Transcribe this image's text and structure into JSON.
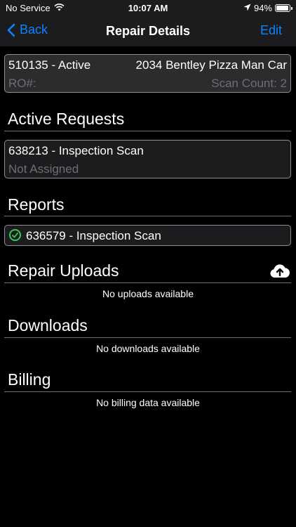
{
  "status": {
    "carrier": "No Service",
    "time": "10:07 AM",
    "battery": "94%",
    "battery_level": 0.94
  },
  "nav": {
    "back_label": "Back",
    "title": "Repair Details",
    "edit_label": "Edit"
  },
  "repair": {
    "id_status": "510135 - Active",
    "vehicle": "2034 Bentley Pizza Man Car",
    "ro_label": "RO#:",
    "scan_count": "Scan Count: 2"
  },
  "active_requests": {
    "title": "Active Requests",
    "items": [
      {
        "label": "638213 - Inspection Scan",
        "assignment": "Not Assigned"
      }
    ]
  },
  "reports": {
    "title": "Reports",
    "items": [
      {
        "label": "636579 - Inspection Scan"
      }
    ]
  },
  "repair_uploads": {
    "title": "Repair Uploads",
    "empty": "No uploads available"
  },
  "downloads": {
    "title": "Downloads",
    "empty": "No downloads available"
  },
  "billing": {
    "title": "Billing",
    "empty": "No billing data available"
  },
  "colors": {
    "accent": "#0a84ff",
    "success": "#34c759",
    "background": "#000000",
    "card": "#1c1c1e"
  }
}
